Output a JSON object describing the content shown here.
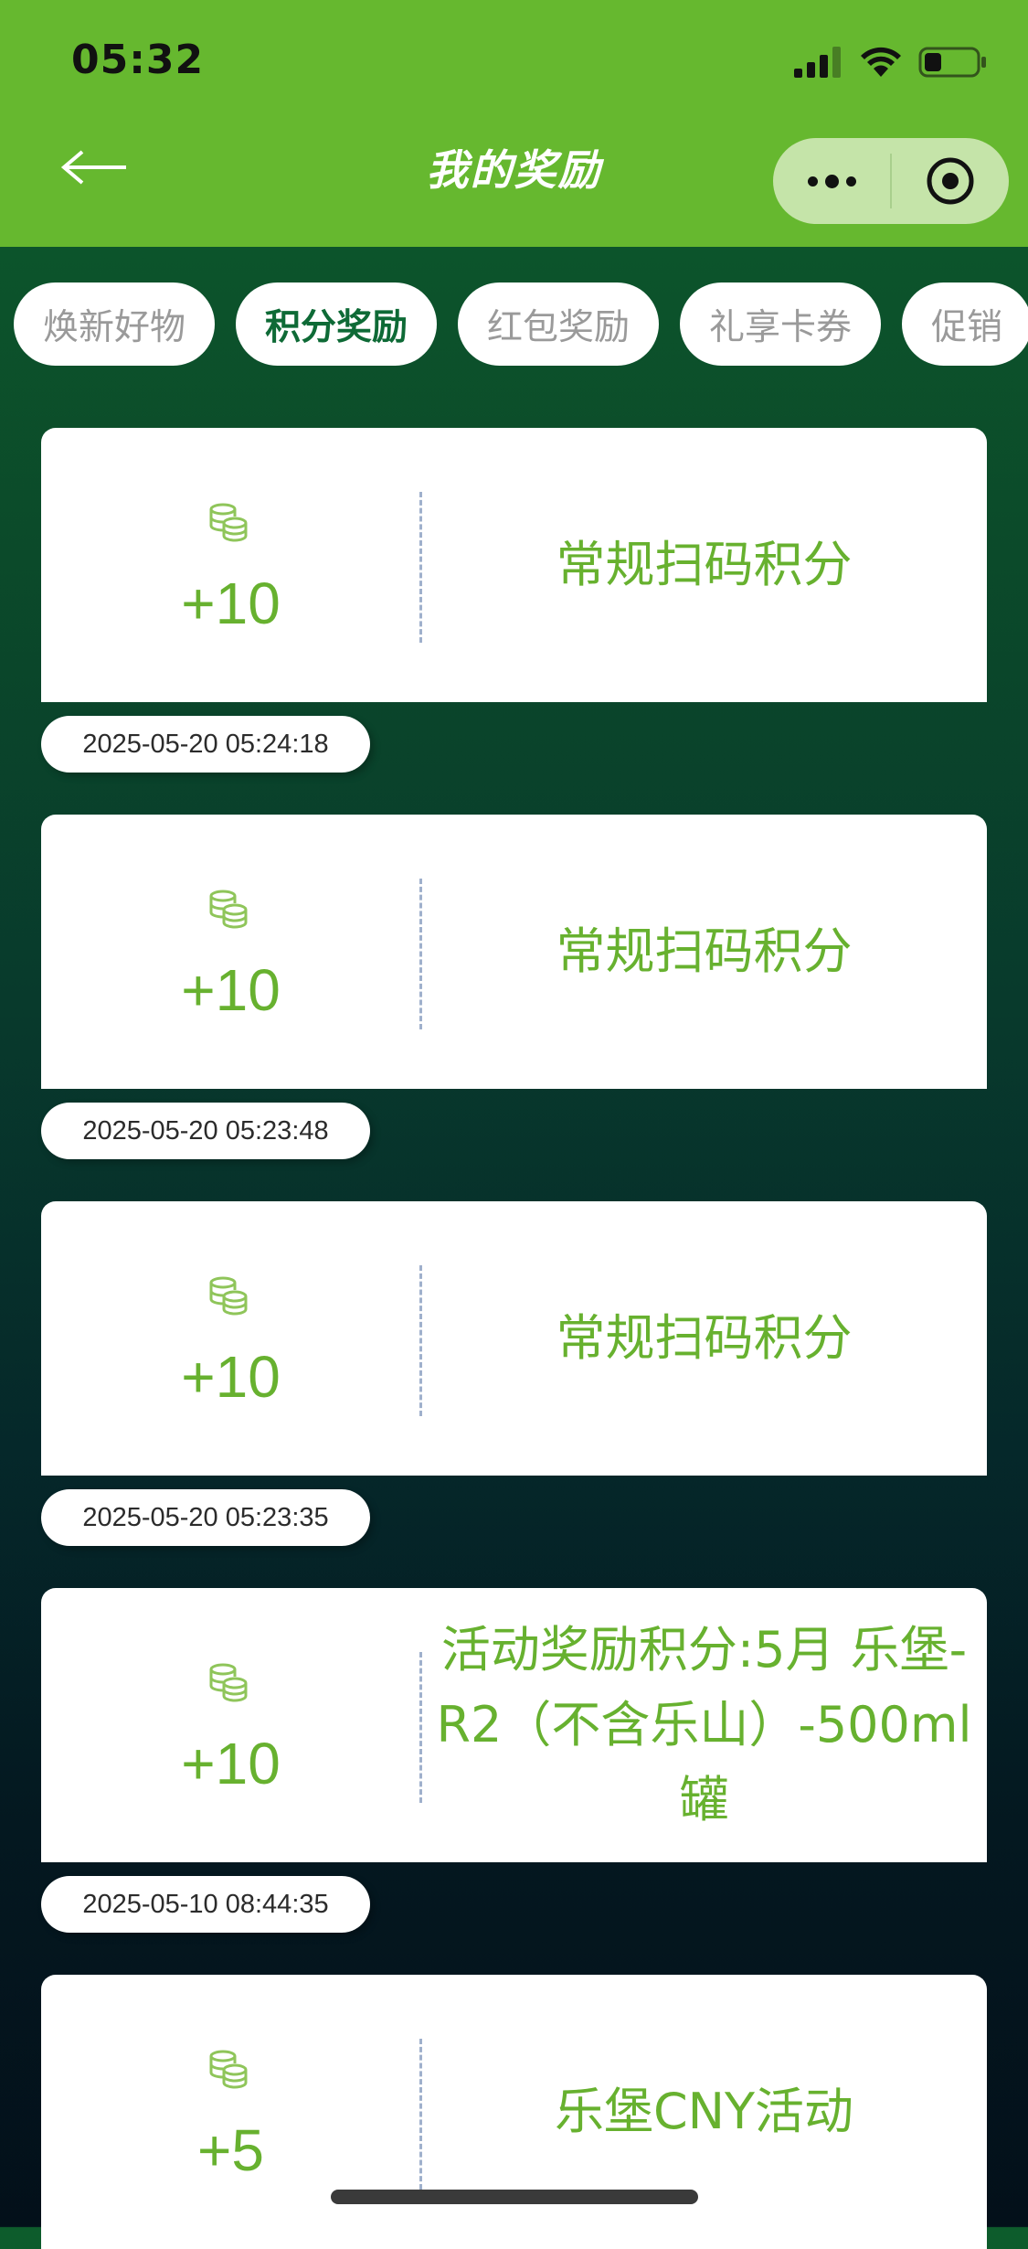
{
  "status_bar": {
    "time": "05:32"
  },
  "nav": {
    "title": "我的奖励"
  },
  "tabs": [
    {
      "label": "焕新好物",
      "active": false
    },
    {
      "label": "积分奖励",
      "active": true
    },
    {
      "label": "红包奖励",
      "active": false
    },
    {
      "label": "礼享卡券",
      "active": false
    },
    {
      "label": "促销",
      "active": false
    }
  ],
  "rewards": [
    {
      "points": "+10",
      "title": "常规扫码积分",
      "time": "2025-05-20 05:24:18",
      "icon": "coins-icon"
    },
    {
      "points": "+10",
      "title": "常规扫码积分",
      "time": "2025-05-20 05:23:48",
      "icon": "coins-icon"
    },
    {
      "points": "+10",
      "title": "常规扫码积分",
      "time": "2025-05-20 05:23:35",
      "icon": "coins-icon"
    },
    {
      "points": "+10",
      "title": "活动奖励积分:5月 乐堡-R2（不含乐山）-500ml罐",
      "time": "2025-05-10 08:44:35",
      "icon": "coins-icon"
    },
    {
      "points": "+5",
      "title": "乐堡CNY活动",
      "time": "",
      "icon": "coins-icon"
    }
  ],
  "colors": {
    "brand_green": "#66b82f",
    "points_green": "#67b12f",
    "active_tab": "#0e6a36"
  }
}
